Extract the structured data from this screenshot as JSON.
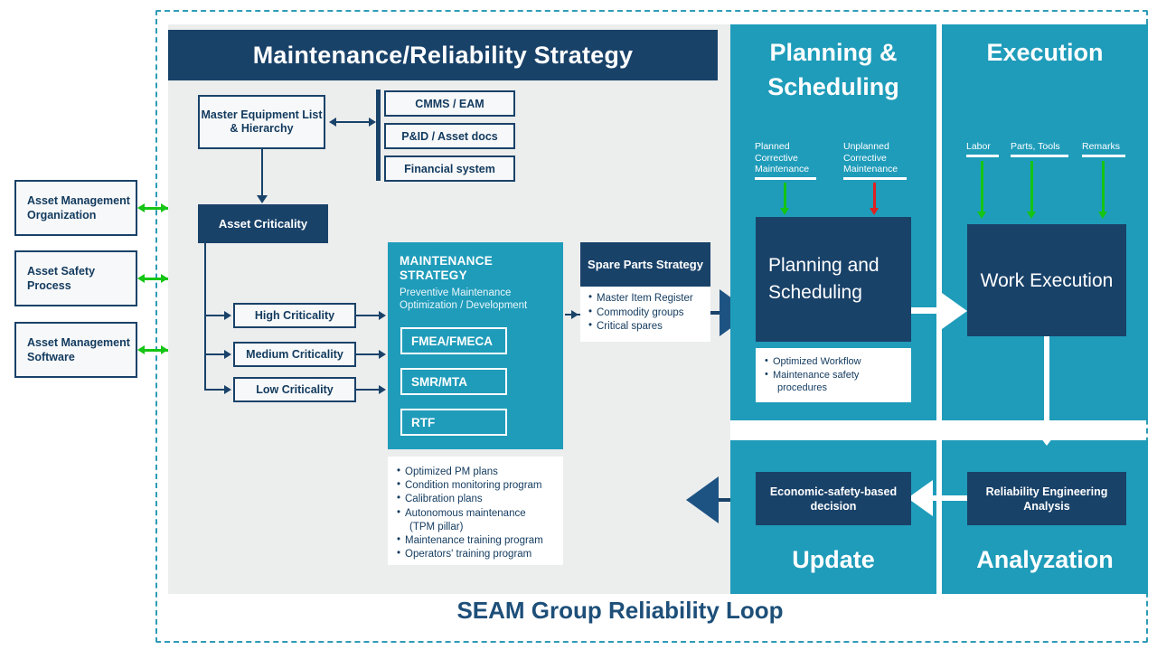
{
  "footer": {
    "title": "SEAM Group Reliability Loop"
  },
  "strategy": {
    "header": "Maintenance/Reliability Strategy",
    "master_equipment": "Master Equipment List & Hierarchy",
    "documents": [
      {
        "label": "CMMS / EAM"
      },
      {
        "label": "P&ID / Asset docs"
      },
      {
        "label": "Financial system"
      }
    ],
    "asset_criticality": "Asset Criticality",
    "criticality_levels": [
      {
        "label": "High Criticality"
      },
      {
        "label": "Medium Criticality"
      },
      {
        "label": "Low Criticality"
      }
    ],
    "maintenance_strategy": {
      "title": "MAINTENANCE STRATEGY",
      "subtitle": "Preventive Maintenance Optimization / Development",
      "methods": [
        {
          "label": "FMEA/FMECA"
        },
        {
          "label": "SMR/MTA"
        },
        {
          "label": "RTF"
        }
      ]
    },
    "pm_outputs": [
      "Optimized PM plans",
      "Condition monitoring program",
      "Calibration plans",
      "Autonomous maintenance",
      "(TPM pillar)",
      "Maintenance training program",
      "Operators' training program"
    ],
    "spare_parts": {
      "title": "Spare Parts Strategy",
      "items": [
        "Master Item Register",
        "Commodity groups",
        "Critical spares"
      ]
    }
  },
  "external": [
    {
      "label": "Asset Management Organization"
    },
    {
      "label": "Asset Safety Process"
    },
    {
      "label": "Asset Management Software"
    }
  ],
  "quadrants": {
    "planning": {
      "title": "Planning & Scheduling",
      "feeds": [
        {
          "label": "Planned Corrective Maintenance",
          "color": "#14c514"
        },
        {
          "label": "Unplanned Corrective Maintenance",
          "color": "#e02020"
        }
      ],
      "box_label": "Planning and Scheduling",
      "outputs": [
        "Optimized Workflow",
        "Maintenance safety",
        "procedures"
      ]
    },
    "execution": {
      "title": "Execution",
      "feeds": [
        {
          "label": "Labor",
          "color": "#14c514"
        },
        {
          "label": "Parts, Tools",
          "color": "#14c514"
        },
        {
          "label": "Remarks",
          "color": "#14c514"
        }
      ],
      "box_label": "Work Execution"
    },
    "update": {
      "title": "Update",
      "box_label": "Economic-safety-based decision"
    },
    "analyzation": {
      "title": "Analyzation",
      "box_label": "Reliability Engineering Analysis"
    }
  },
  "colors": {
    "navy": "#194269",
    "teal": "#1f9cba",
    "panel_gray": "#eceded",
    "green": "#14c514",
    "red": "#e02020",
    "footer_blue": "#1d4f79"
  }
}
